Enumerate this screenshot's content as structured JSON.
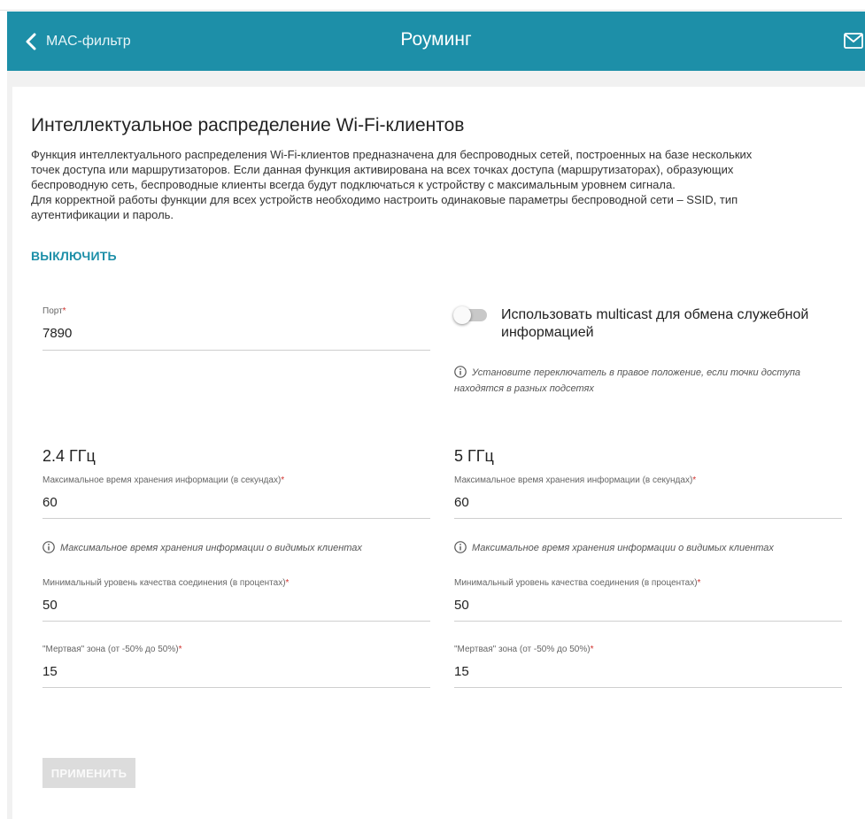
{
  "header": {
    "back_label": "MAC-фильтр",
    "title": "Роуминг",
    "accent_color": "#1d8fa8"
  },
  "section": {
    "title": "Интеллектуальное распределение Wi-Fi-клиентов",
    "description_lines": [
      "Функция интеллектуального распределения Wi-Fi-клиентов предназначена для беспроводных сетей, построенных на базе нескольких",
      "точек доступа или маршрутизаторов. Если данная функция активирована на всех точках доступа (маршрутизаторах), образующих",
      "беспроводную сеть, беспроводные клиенты всегда будут подключаться к устройству с максимальным уровнем сигнала.",
      "Для корректной работы функции для всех устройств необходимо настроить одинаковые параметры беспроводной сети – SSID, тип",
      "аутентификации и пароль."
    ],
    "disable_link": "ВЫКЛЮЧИТЬ"
  },
  "port": {
    "label": "Порт",
    "required_mark": "*",
    "value": "7890"
  },
  "multicast": {
    "label": "Использовать multicast для обмена служебной информацией",
    "enabled": false,
    "hint_line1": "Установите переключатель в правое положение, если точки доступа",
    "hint_line2": "находятся в разных подсетях"
  },
  "band24": {
    "title": "2.4 ГГц",
    "max_time_label": "Максимальное время хранения информации (в секундах)",
    "max_time_value": "60",
    "max_time_hint": "Максимальное время хранения информации о видимых клиентах",
    "min_quality_label": "Минимальный уровень качества соединения (в процентах)",
    "min_quality_value": "50",
    "dead_zone_label": "\"Мертвая\" зона (от -50% до 50%)",
    "dead_zone_value": "15"
  },
  "band5": {
    "title": "5 ГГц",
    "max_time_label": "Максимальное время хранения информации (в секундах)",
    "max_time_value": "60",
    "max_time_hint": "Максимальное время хранения информации о видимых клиентах",
    "min_quality_label": "Минимальный уровень качества соединения (в процентах)",
    "min_quality_value": "50",
    "dead_zone_label": "\"Мертвая\" зона (от -50% до 50%)",
    "dead_zone_value": "15"
  },
  "apply_label": "ПРИМЕНИТЬ",
  "required_mark": "*"
}
